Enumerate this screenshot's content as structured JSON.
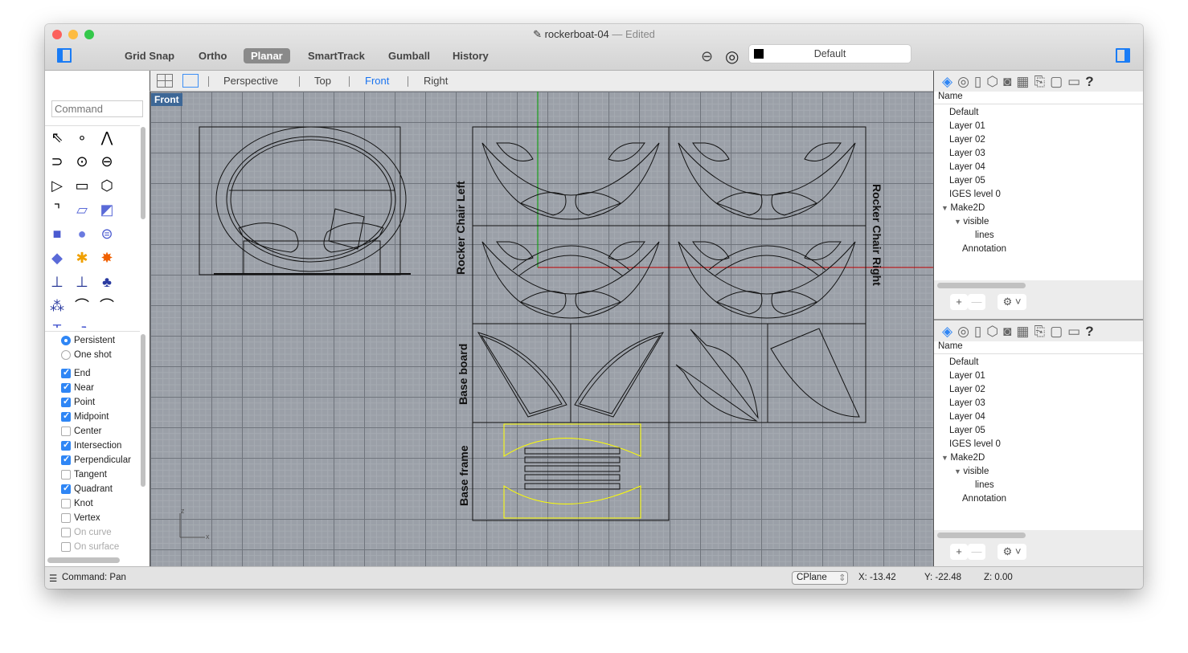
{
  "window": {
    "title": "rockerboat-04",
    "separator": "—",
    "edited": "Edited"
  },
  "toolbar": {
    "buttons": [
      {
        "label": "Grid Snap",
        "active": false
      },
      {
        "label": "Ortho",
        "active": false
      },
      {
        "label": "Planar",
        "active": true
      },
      {
        "label": "SmartTrack",
        "active": false
      },
      {
        "label": "Gumball",
        "active": false
      },
      {
        "label": "History",
        "active": false
      }
    ],
    "layer": "Default",
    "layer_color": "#000000"
  },
  "viewport_tabs": [
    "Perspective",
    "Top",
    "Front",
    "Right"
  ],
  "active_viewport": "Front",
  "command": {
    "placeholder": "Command"
  },
  "tools": [
    "select-arrow",
    "point",
    "polyline",
    "curve-cv",
    "circle",
    "ellipse",
    "arc",
    "rectangle",
    "polygon",
    "fillet-curves",
    "surface-from-points",
    "extrude-surface",
    "box",
    "sphere",
    "cylinder",
    "planar-surface",
    "boolean-split",
    "explode",
    "split",
    "trim",
    "join",
    "group",
    "offset-curve",
    "curve-blend",
    "text",
    "move",
    "array"
  ],
  "snap_mode": [
    {
      "label": "Persistent",
      "on": true
    },
    {
      "label": "One shot",
      "on": false
    }
  ],
  "osnaps": [
    {
      "label": "End",
      "on": true
    },
    {
      "label": "Near",
      "on": true
    },
    {
      "label": "Point",
      "on": true
    },
    {
      "label": "Midpoint",
      "on": true
    },
    {
      "label": "Center",
      "on": false
    },
    {
      "label": "Intersection",
      "on": true
    },
    {
      "label": "Perpendicular",
      "on": true
    },
    {
      "label": "Tangent",
      "on": false
    },
    {
      "label": "Quadrant",
      "on": true
    },
    {
      "label": "Knot",
      "on": false
    },
    {
      "label": "Vertex",
      "on": false
    },
    {
      "label": "On curve",
      "on": false,
      "disabled": true
    },
    {
      "label": "On surface",
      "on": false,
      "disabled": true
    }
  ],
  "drawing": {
    "labels": {
      "left": "Rocker Chair Left",
      "right": "Rocker Chair Right",
      "base_board": "Base board",
      "base_frame": "Base frame"
    },
    "axis": {
      "z": "z",
      "x": "x"
    },
    "colors": {
      "x_axis": "#c00000",
      "y_axis": "#00a000",
      "selected": "#ffff00",
      "grid": "#9ba0a8"
    }
  },
  "layers_panel": {
    "header": "Name",
    "items": [
      {
        "label": "Default",
        "level": 0
      },
      {
        "label": "Layer 01",
        "level": 0
      },
      {
        "label": "Layer 02",
        "level": 0
      },
      {
        "label": "Layer 03",
        "level": 0
      },
      {
        "label": "Layer 04",
        "level": 0
      },
      {
        "label": "Layer 05",
        "level": 0
      },
      {
        "label": "IGES level 0",
        "level": 0
      },
      {
        "label": "Make2D",
        "level": 0,
        "expanded": true
      },
      {
        "label": "visible",
        "level": 1,
        "expanded": true
      },
      {
        "label": "lines",
        "level": 2
      },
      {
        "label": "Annotation",
        "level": 1
      }
    ],
    "tabs": [
      "layers-icon",
      "display-icon",
      "properties-icon",
      "object-icon",
      "named-views-icon",
      "named-cplanes-icon",
      "notes-icon",
      "layouts-icon",
      "display-modes-icon",
      "help-icon"
    ],
    "add": "+",
    "remove": "—",
    "gear": "⚙ ˅"
  },
  "status": {
    "command": "Command: Pan",
    "cplane": "CPlane",
    "x": "X: -13.42",
    "y": "Y: -22.48",
    "z": "Z: 0.00"
  }
}
